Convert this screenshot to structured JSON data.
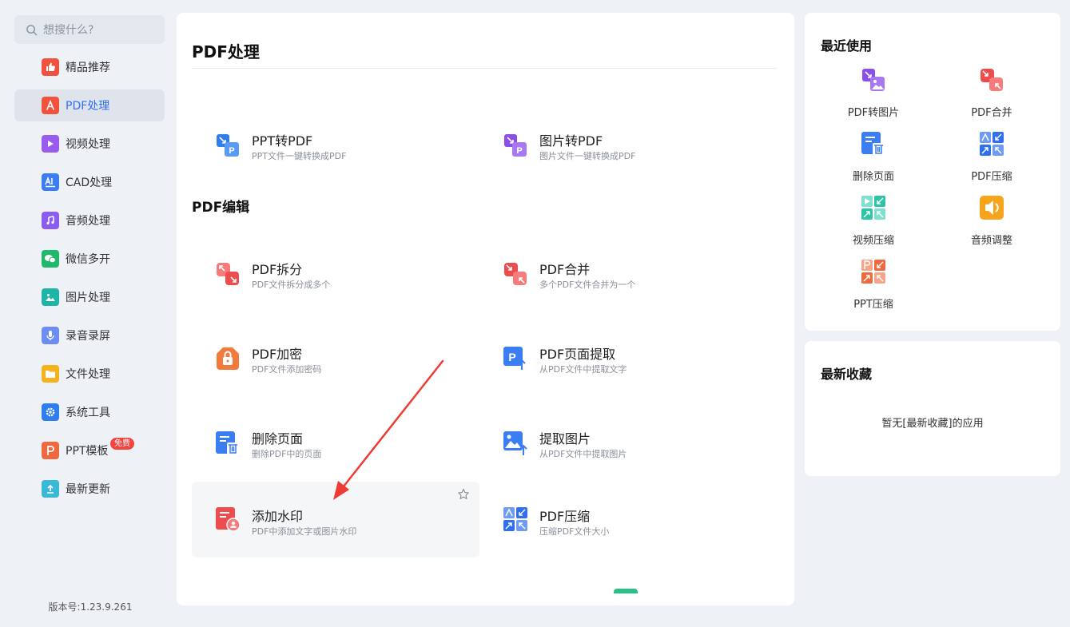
{
  "sidebar": {
    "search_placeholder": "想搜什么?",
    "items": [
      {
        "label": "精品推荐",
        "icon": "thumbs-up-icon",
        "color": "#f0523e"
      },
      {
        "label": "PDF处理",
        "icon": "pdf-icon",
        "color": "#f0523e"
      },
      {
        "label": "视频处理",
        "icon": "video-play-icon",
        "color": "#9a5cf0"
      },
      {
        "label": "CAD处理",
        "icon": "cad-icon",
        "color": "#3b7df2"
      },
      {
        "label": "音频处理",
        "icon": "music-icon",
        "color": "#8b5cf0"
      },
      {
        "label": "微信多开",
        "icon": "wechat-icon",
        "color": "#22b86b"
      },
      {
        "label": "图片处理",
        "icon": "image-icon",
        "color": "#1fb4a8"
      },
      {
        "label": "录音录屏",
        "icon": "microphone-icon",
        "color": "#6d8df2"
      },
      {
        "label": "文件处理",
        "icon": "folder-icon",
        "color": "#f6b21c"
      },
      {
        "label": "系统工具",
        "icon": "gear-icon",
        "color": "#2f7ef0"
      },
      {
        "label": "PPT模板",
        "icon": "ppt-icon",
        "color": "#f0683e",
        "badge": "免费"
      },
      {
        "label": "最新更新",
        "icon": "upload-icon",
        "color": "#39b8d8"
      }
    ],
    "version": "版本号:1.23.9.261"
  },
  "main": {
    "title": "PDF处理",
    "section_edit": "PDF编辑",
    "tools": [
      {
        "name": "PPT转PDF",
        "desc": "PPT文件一键转换成PDF",
        "icon": "ppt-to-pdf-icon"
      },
      {
        "name": "图片转PDF",
        "desc": "图片文件一键转换成PDF",
        "icon": "image-to-pdf-icon"
      },
      {
        "name": "PDF拆分",
        "desc": "PDF文件拆分成多个",
        "icon": "pdf-split-icon"
      },
      {
        "name": "PDF合并",
        "desc": "多个PDF文件合并为一个",
        "icon": "pdf-merge-icon"
      },
      {
        "name": "PDF加密",
        "desc": "PDF文件添加密码",
        "icon": "lock-icon"
      },
      {
        "name": "PDF页面提取",
        "desc": "从PDF文件中提取文字",
        "icon": "page-extract-icon"
      },
      {
        "name": "删除页面",
        "desc": "删除PDF中的页面",
        "icon": "delete-page-icon"
      },
      {
        "name": "提取图片",
        "desc": "从PDF文件中提取图片",
        "icon": "extract-image-icon"
      },
      {
        "name": "添加水印",
        "desc": "PDF中添加文字或图片水印",
        "icon": "watermark-icon"
      },
      {
        "name": "PDF压缩",
        "desc": "压缩PDF文件大小",
        "icon": "pdf-compress-icon"
      }
    ]
  },
  "recent": {
    "title": "最近使用",
    "items": [
      {
        "label": "PDF转图片",
        "icon": "pdf-to-image-icon"
      },
      {
        "label": "PDF合并",
        "icon": "pdf-merge-icon"
      },
      {
        "label": "删除页面",
        "icon": "delete-page-icon"
      },
      {
        "label": "PDF压缩",
        "icon": "pdf-compress-icon"
      },
      {
        "label": "视频压缩",
        "icon": "video-compress-icon"
      },
      {
        "label": "音频调整",
        "icon": "audio-adjust-icon"
      },
      {
        "label": "PPT压缩",
        "icon": "ppt-compress-icon"
      }
    ]
  },
  "favorites": {
    "title": "最新收藏",
    "empty_text": "暂无[最新收藏]的应用"
  },
  "colors": {
    "accent": "#2f6ff0",
    "annotation_arrow": "#ee3b34"
  }
}
